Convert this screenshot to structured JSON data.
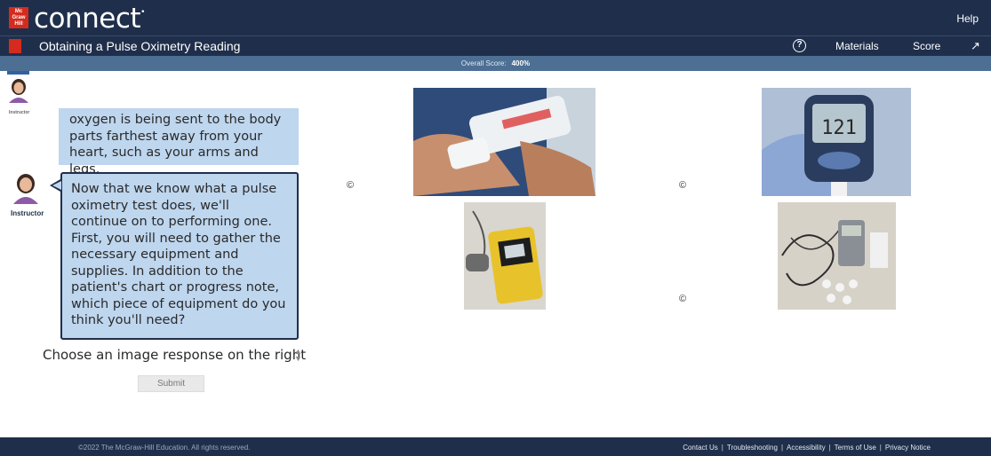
{
  "header": {
    "logo_text": "Mc Graw Hill",
    "brand": "connect",
    "help_label": "Help"
  },
  "subheader": {
    "activity_title": "Obtaining a Pulse Oximetry Reading",
    "help_icon_glyph": "?",
    "materials_label": "Materials",
    "score_label": "Score",
    "expand_icon_glyph": "↗"
  },
  "score_bar": {
    "label": "Overall Score:",
    "value": "400%"
  },
  "chat": {
    "previous_speaker": "Instructor",
    "previous_message": "oxygen is being sent to the body parts farthest away from your heart, such as your arms and legs.",
    "current_speaker": "Instructor",
    "current_message": "Now that we know what a pulse oximetry test does, we'll continue on to performing one. First, you will need to gather the necessary equipment and supplies.  In addition to the patient's chart or progress note, which piece of equipment do you think you'll need?"
  },
  "response": {
    "prompt": "Choose an image response on the right",
    "submit_label": "Submit"
  },
  "choices": {
    "copyright_symbol": "©",
    "items": [
      {
        "id": "peak-flow-meter",
        "icon": "peak-flow-meter-icon"
      },
      {
        "id": "glucose-meter",
        "icon": "glucose-meter-icon",
        "reading": "121"
      },
      {
        "id": "pulse-oximeter",
        "icon": "pulse-oximeter-icon"
      },
      {
        "id": "ecg-holter-monitor",
        "icon": "holter-monitor-icon"
      }
    ]
  },
  "footer": {
    "copyright": "©2022 The McGraw-Hill Education. All rights reserved.",
    "links": [
      "Contact Us",
      "Troubleshooting",
      "Accessibility",
      "Terms of Use",
      "Privacy Notice"
    ]
  },
  "colors": {
    "navy": "#1f2f4b",
    "score_bar": "#4d6f93",
    "bubble": "#bed6ee",
    "brand_red": "#d52b1e"
  }
}
